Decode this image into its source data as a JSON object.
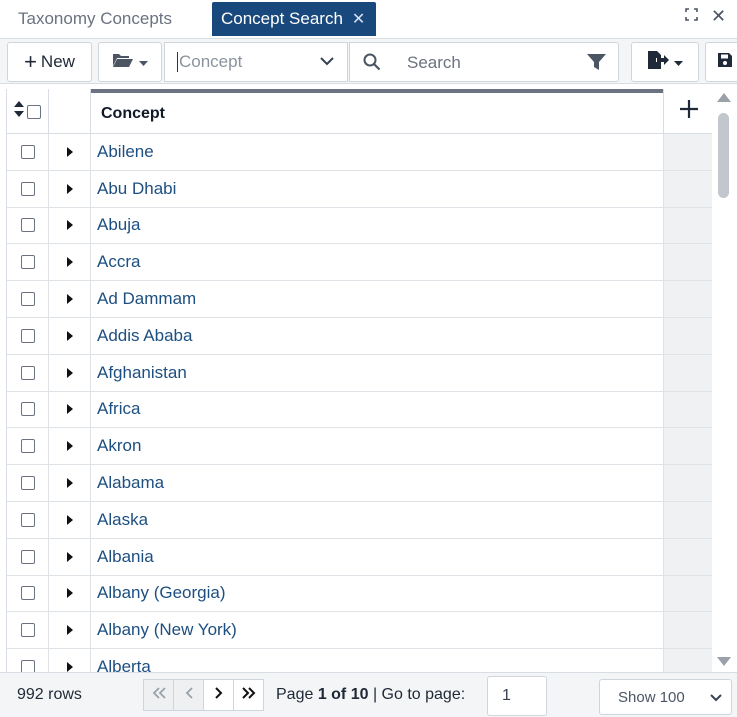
{
  "tabs": [
    {
      "label": "Taxonomy Concepts",
      "active": false
    },
    {
      "label": "Concept Search",
      "active": true
    }
  ],
  "toolbar": {
    "new_label": "New",
    "concept_select_value": "Concept",
    "search_placeholder": "Search"
  },
  "grid": {
    "column_header": "Concept",
    "rows": [
      "Abilene",
      "Abu Dhabi",
      "Abuja",
      "Accra",
      "Ad Dammam",
      "Addis Ababa",
      "Afghanistan",
      "Africa",
      "Akron",
      "Alabama",
      "Alaska",
      "Albania",
      "Albany (Georgia)",
      "Albany (New York)",
      "Alberta"
    ]
  },
  "footer": {
    "row_count": "992 rows",
    "page_prefix": "Page ",
    "page_current": "1 of 10",
    "goto_label": " | Go to page:",
    "goto_value": "1",
    "show_label": "Show 100"
  },
  "colors": {
    "active_tab": "#19497c",
    "link": "#1d4f80"
  }
}
